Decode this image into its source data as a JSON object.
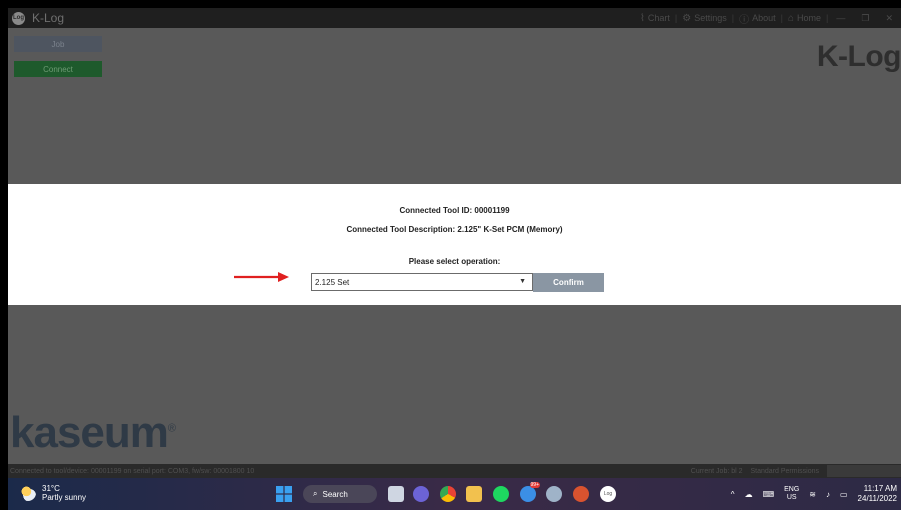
{
  "app": {
    "title": "K-Log",
    "logo_text": "Log"
  },
  "top_nav": {
    "items": [
      {
        "label": "Chart",
        "icon": "chart-icon"
      },
      {
        "label": "Settings",
        "icon": "gear-icon"
      },
      {
        "label": "About",
        "icon": "info-icon"
      },
      {
        "label": "Home",
        "icon": "home-icon"
      }
    ]
  },
  "sidebar": {
    "job_label": "Job",
    "connect_label": "Connect"
  },
  "brand": {
    "klog": "K-Log",
    "kaseum": "kaseum",
    "registered": "®"
  },
  "modal": {
    "tool_id": "Connected Tool ID: 00001199",
    "tool_description": "Connected Tool Description: 2.125\" K-Set PCM (Memory)",
    "select_label": "Please select operation:",
    "operation_value": "2.125 Set",
    "confirm_label": "Confirm"
  },
  "status_bar": {
    "connection_text": "Connected to tool/device: 00001199 on serial port: COM3, fw/sw: 00001800 10",
    "current_job": "Current Job: bl 2",
    "permissions": "Standard Permissions"
  },
  "taskbar": {
    "temperature": "31°C",
    "weather": "Partly sunny",
    "search_label": "Search",
    "language": "ENG",
    "region": "US",
    "time": "11:17 AM",
    "date": "24/11/2022",
    "badge_count": "99+"
  },
  "colors": {
    "accent_arrow": "#e02020",
    "confirm_button": "#8a96a3",
    "connect_button": "#1e5a2c"
  }
}
